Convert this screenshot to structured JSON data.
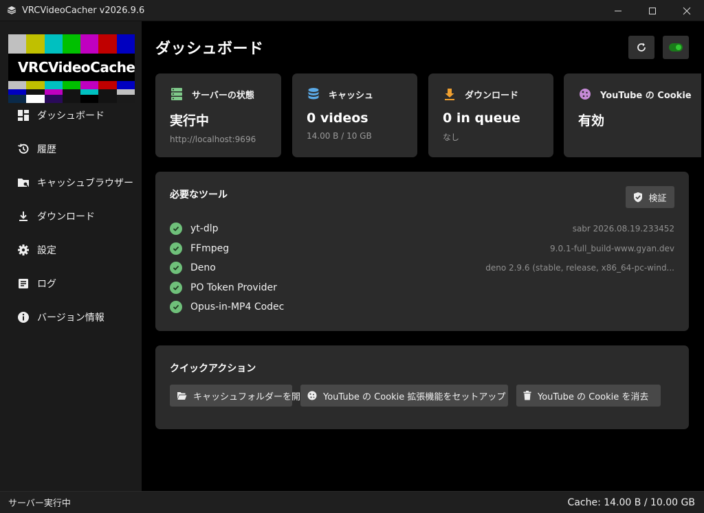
{
  "window": {
    "title": "VRCVideoCacher v2026.9.6",
    "app_icon": "stack-icon",
    "minimize_label": "—",
    "maximize_label": "☐",
    "close_label": "✕"
  },
  "sidebar": {
    "logo_text": "VRCVideoCacher",
    "items": [
      {
        "label": "ダッシュボード",
        "icon": "dashboard-icon"
      },
      {
        "label": "履歴",
        "icon": "history-icon"
      },
      {
        "label": "キャッシュブラウザー",
        "icon": "folder-browser-icon"
      },
      {
        "label": "ダウンロード",
        "icon": "download-icon"
      },
      {
        "label": "設定",
        "icon": "gear-icon"
      },
      {
        "label": "ログ",
        "icon": "log-icon"
      },
      {
        "label": "バージョン情報",
        "icon": "info-icon"
      }
    ]
  },
  "main": {
    "title": "ダッシュボード",
    "cards": [
      {
        "title": "サーバーの状態",
        "value": "実行中",
        "sub": "http://localhost:9696",
        "icon": "server-icon",
        "icon_color": "#7fc98a"
      },
      {
        "title": "キャッシュ",
        "value": "0 videos",
        "sub": "14.00 B  /  10 GB",
        "icon": "database-icon",
        "icon_color": "#5aa9e6"
      },
      {
        "title": "ダウンロード",
        "value": "0 in queue",
        "sub": "なし",
        "icon": "download-icon",
        "icon_color": "#f0a030"
      },
      {
        "title": "YouTube の Cookie",
        "value": "有効",
        "sub": "",
        "icon": "cookie-icon",
        "icon_color": "#c58ad6"
      }
    ],
    "tools": {
      "title": "必要なツール",
      "verify_label": "検証",
      "items": [
        {
          "name": "yt-dlp",
          "version": "sabr 2026.08.19.233452"
        },
        {
          "name": "FFmpeg",
          "version": "9.0.1-full_build-www.gyan.dev"
        },
        {
          "name": "Deno",
          "version": "deno 2.9.6 (stable, release, x86_64-pc-wind..."
        },
        {
          "name": "PO Token Provider",
          "version": ""
        },
        {
          "name": "Opus-in-MP4 Codec",
          "version": ""
        }
      ]
    },
    "quick_actions": {
      "title": "クイックアクション",
      "buttons": [
        {
          "label": "キャッシュフォルダーを開く",
          "icon": "folder-open-icon"
        },
        {
          "label": "YouTube の Cookie 拡張機能をセットアップ",
          "icon": "cookie-icon"
        },
        {
          "label": "YouTube の Cookie を消去",
          "icon": "trash-icon"
        }
      ]
    }
  },
  "statusbar": {
    "left": "サーバー実行中",
    "right": "Cache: 14.00 B / 10.00 GB"
  },
  "colors": {
    "accent_green": "#1a7a1a",
    "check_green": "#6fc07a"
  }
}
